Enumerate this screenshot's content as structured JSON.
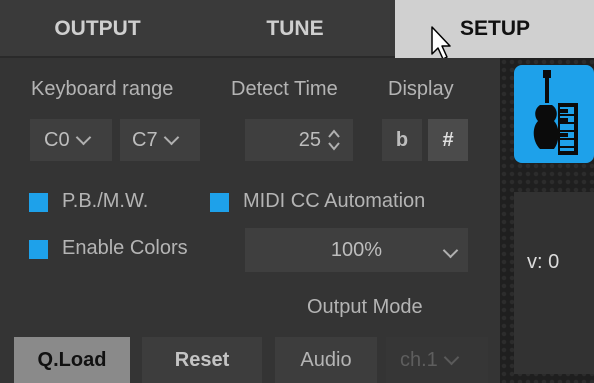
{
  "tabs": {
    "output": "OUTPUT",
    "tune": "TUNE",
    "setup": "SETUP"
  },
  "setup": {
    "keyboard_range_label": "Keyboard range",
    "detect_time_label": "Detect Time",
    "display_label": "Display",
    "range_low": "C0",
    "range_high": "C7",
    "detect_time_value": "25",
    "display_flat": "b",
    "display_sharp": "#",
    "pbmw_label": "P.B./M.W.",
    "midi_cc_label": "MIDI CC Automation",
    "enable_colors_label": "Enable Colors",
    "zoom_value": "100%",
    "output_mode_label": "Output Mode",
    "qload_label": "Q.Load",
    "reset_label": "Reset",
    "audio_label": "Audio",
    "channel_value": "ch.1"
  },
  "side": {
    "instrument_icon": "guitar-keyboard-icon",
    "velocity_text": "v: 0"
  },
  "colors": {
    "accent": "#1ea1ea",
    "active_tab": "#d0d0d0",
    "panel": "#343434"
  }
}
